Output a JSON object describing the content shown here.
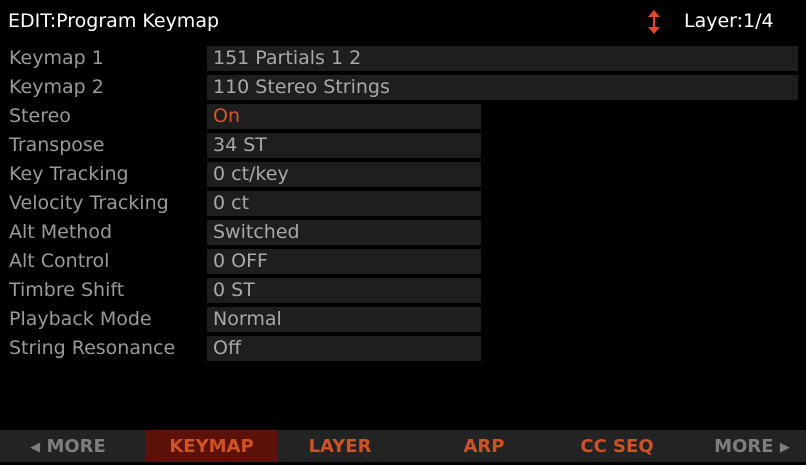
{
  "header": {
    "title": "EDIT:Program Keymap",
    "layer_label": "Layer:1/4",
    "layer_icon": "up-down-arrows-icon"
  },
  "params": [
    {
      "label": "Keymap 1",
      "value": "151 Partials 1 2"
    },
    {
      "label": "Keymap 2",
      "value": "110 Stereo Strings"
    },
    {
      "label": "Stereo",
      "value": "On"
    },
    {
      "label": "Transpose",
      "value": "34 ST"
    },
    {
      "label": "Key Tracking",
      "value": "0 ct/key"
    },
    {
      "label": "Velocity Tracking",
      "value": "0 ct"
    },
    {
      "label": "Alt Method",
      "value": "Switched"
    },
    {
      "label": "Alt Control",
      "value": "0 OFF"
    },
    {
      "label": "Timbre Shift",
      "value": "0 ST"
    },
    {
      "label": "Playback Mode",
      "value": "Normal"
    },
    {
      "label": "String Resonance",
      "value": "Off"
    }
  ],
  "softkeys": {
    "more_left": "MORE",
    "keymap": "KEYMAP",
    "layer": "LAYER",
    "arp": "ARP",
    "cc_seq": "CC SEQ",
    "more_right": "MORE"
  },
  "colors": {
    "accent": "#cf5324",
    "active_tab_bg": "#5c1208",
    "value_on": "#d2552a"
  }
}
